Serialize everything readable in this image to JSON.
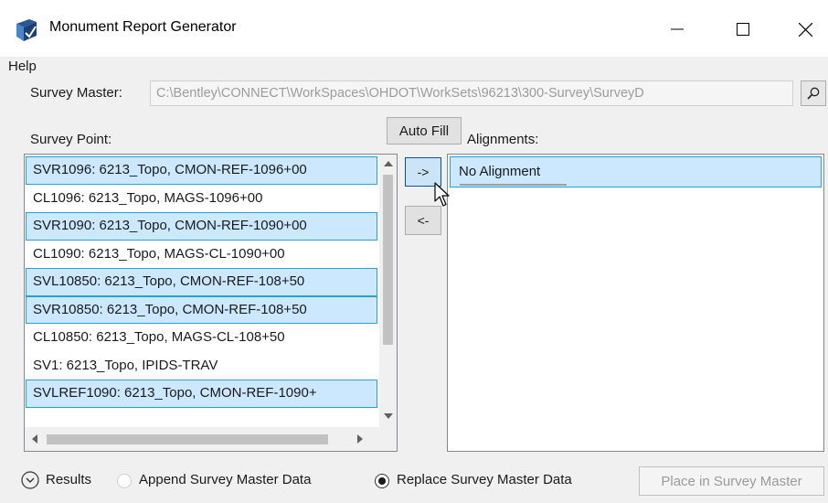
{
  "window": {
    "title": "Monument Report Generator",
    "icon": "bentley-app-icon",
    "controls": {
      "minimize_icon": "minimize-icon",
      "maximize_icon": "maximize-icon",
      "close_icon": "close-icon"
    }
  },
  "menu": {
    "items": [
      {
        "label": "Help"
      }
    ]
  },
  "survey_master": {
    "label": "Survey Master:",
    "value": "C:\\Bentley\\CONNECT\\WorkSpaces\\OHDOT\\WorkSets\\96213\\300-Survey\\SurveyD",
    "browse_icon": "search-icon"
  },
  "survey_point": {
    "label": "Survey Point:",
    "items": [
      {
        "text": "SVR1096: 6213_Topo, CMON-REF-1096+00",
        "selected": true
      },
      {
        "text": "CL1096: 6213_Topo, MAGS-1096+00",
        "selected": false
      },
      {
        "text": "SVR1090: 6213_Topo, CMON-REF-1090+00",
        "selected": true
      },
      {
        "text": "CL1090: 6213_Topo, MAGS-CL-1090+00",
        "selected": false
      },
      {
        "text": "SVL10850: 6213_Topo, CMON-REF-108+50",
        "selected": true
      },
      {
        "text": "SVR10850: 6213_Topo, CMON-REF-108+50",
        "selected": true
      },
      {
        "text": "CL10850: 6213_Topo, MAGS-CL-108+50",
        "selected": false
      },
      {
        "text": "SV1: 6213_Topo, IPIDS-TRAV",
        "selected": false
      },
      {
        "text": "SVLREF1090: 6213_Topo, CMON-REF-1090+",
        "selected": true
      }
    ]
  },
  "buttons": {
    "auto_fill": "Auto Fill",
    "move_right": "->",
    "move_left": "<-",
    "place": "Place in Survey Master"
  },
  "alignments": {
    "label": "Alignments:",
    "items": [
      {
        "text": "No Alignment",
        "selected": true
      }
    ]
  },
  "options": {
    "results_label": "Results",
    "append_label": "Append Survey Master Data",
    "replace_label": "Replace Survey Master Data",
    "append_checked": false,
    "replace_checked": true
  },
  "colors": {
    "selection_fill": "#cce8ff",
    "selection_border": "#26a0da",
    "hover_button": "#cce4f7"
  }
}
